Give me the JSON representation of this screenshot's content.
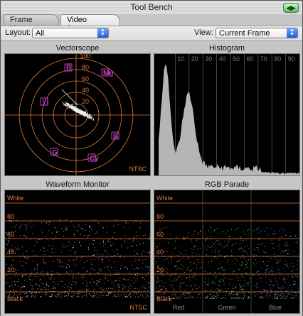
{
  "window": {
    "title": "Tool Bench"
  },
  "tabs": [
    {
      "label": "Frame Viewer",
      "active": false
    },
    {
      "label": "Video Scopes",
      "active": true
    }
  ],
  "toolbar": {
    "layout_label": "Layout:",
    "layout_value": "All",
    "view_label": "View:",
    "view_value": "Current Frame"
  },
  "scopes": {
    "vectorscope": {
      "title": "Vectorscope",
      "scale": [
        "100",
        "80",
        "60",
        "40",
        "20"
      ],
      "targets": [
        "R",
        "Mg",
        "B",
        "Cy",
        "G",
        "Yl"
      ],
      "standard": "NTSC"
    },
    "histogram": {
      "title": "Histogram",
      "ticks": [
        "10",
        "20",
        "30",
        "40",
        "50",
        "60",
        "70",
        "80",
        "90"
      ]
    },
    "waveform": {
      "title": "Waveform Monitor",
      "top_label": "White",
      "bottom_label": "Black",
      "scale": [
        "80",
        "60",
        "40",
        "20"
      ],
      "standard": "NTSC"
    },
    "rgb_parade": {
      "title": "RGB Parade",
      "top_label": "White",
      "bottom_label": "Black",
      "scale": [
        "80",
        "60",
        "40",
        "20"
      ],
      "channels": [
        "Red",
        "Green",
        "Blue"
      ]
    }
  },
  "colors": {
    "graticule": "#e07a3a",
    "target": "#c040c0",
    "trace": "#e8e8e8",
    "histogram": "#b5b5b5"
  }
}
